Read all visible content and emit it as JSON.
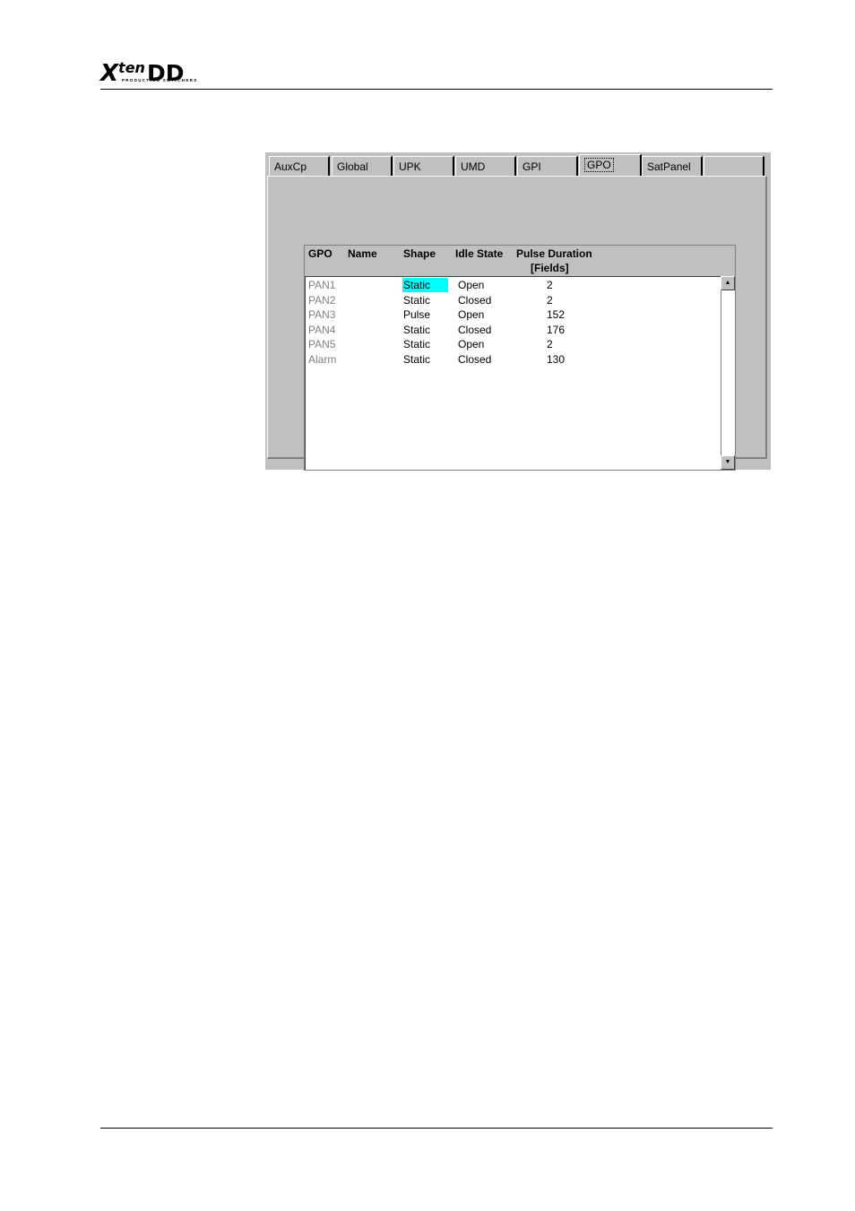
{
  "header": {
    "logo_main": "X",
    "logo_sup": "ten",
    "logo_dd": "DD",
    "logo_sub": "PRODUCTION SWITCHERS"
  },
  "tabs": [
    {
      "label": "AuxCp"
    },
    {
      "label": "Global"
    },
    {
      "label": "UPK"
    },
    {
      "label": "UMD"
    },
    {
      "label": "GPI"
    },
    {
      "label": "GPO"
    },
    {
      "label": "SatPanel"
    },
    {
      "label": ""
    }
  ],
  "active_tab": "GPO",
  "grid": {
    "columns": {
      "gpo": "GPO",
      "name": "Name",
      "shape": "Shape",
      "idle": "Idle State",
      "pulse": "Pulse Duration",
      "pulse_unit": "[Fields]"
    },
    "rows": [
      {
        "gpo": "PAN1",
        "name": "",
        "shape": "Static",
        "idle": "Open",
        "pulse": "2"
      },
      {
        "gpo": "PAN2",
        "name": "",
        "shape": "Static",
        "idle": "Closed",
        "pulse": "2"
      },
      {
        "gpo": "PAN3",
        "name": "",
        "shape": "Pulse",
        "idle": "Open",
        "pulse": "152"
      },
      {
        "gpo": "PAN4",
        "name": "",
        "shape": "Static",
        "idle": "Closed",
        "pulse": "176"
      },
      {
        "gpo": "PAN5",
        "name": "",
        "shape": "Static",
        "idle": "Open",
        "pulse": "2"
      },
      {
        "gpo": "Alarm",
        "name": "",
        "shape": "Static",
        "idle": "Closed",
        "pulse": "130"
      }
    ],
    "selected_cell": {
      "row": 1,
      "column": "shape",
      "color": "#00ffff"
    }
  },
  "icons": {
    "scroll_up": "arrow-up-icon",
    "scroll_down": "arrow-down-icon"
  }
}
